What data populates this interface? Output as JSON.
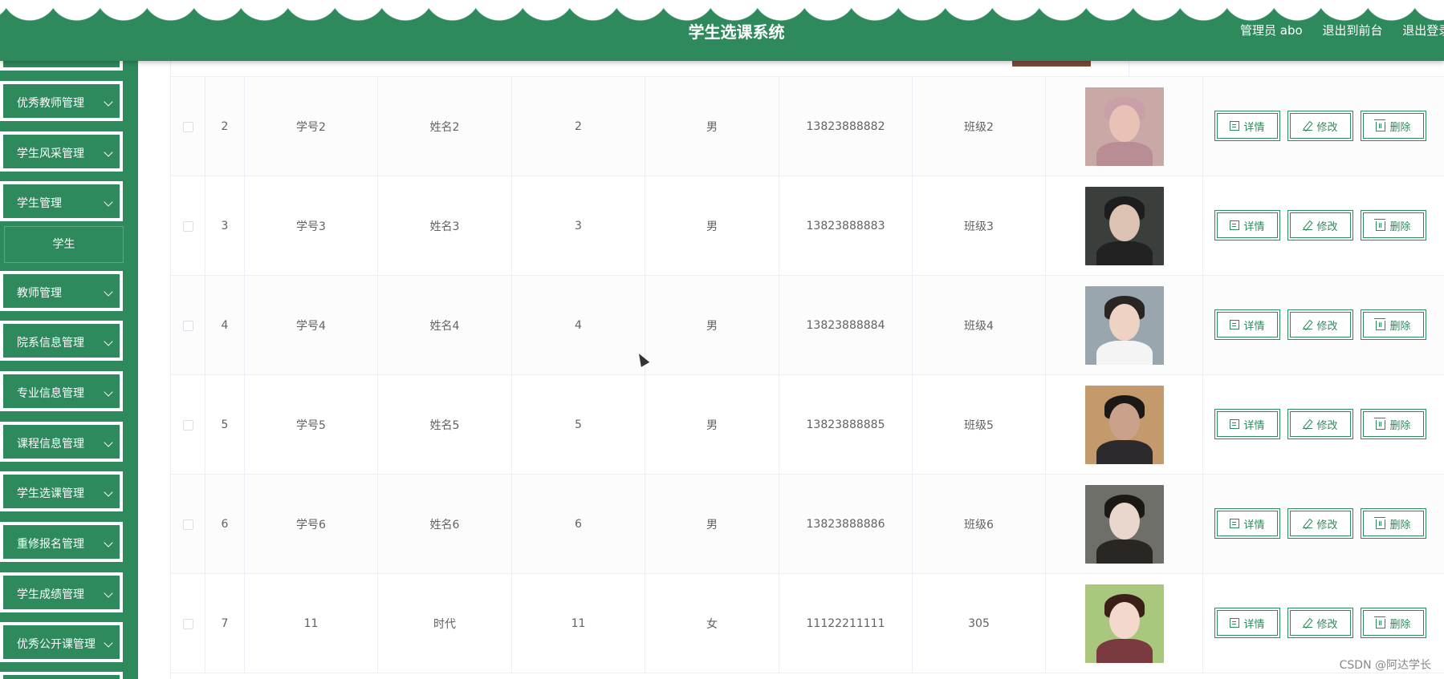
{
  "header": {
    "title": "学生选课系统",
    "user_label": "管理员 abo",
    "back_label": "退出到前台",
    "logout_label": "退出登录"
  },
  "sidebar": {
    "items": [
      {
        "label": "优秀教师管理",
        "type": "menu"
      },
      {
        "label": "学生风采管理",
        "type": "menu"
      },
      {
        "label": "学生管理",
        "type": "menu"
      },
      {
        "label": "学生",
        "type": "submenu"
      },
      {
        "label": "教师管理",
        "type": "menu"
      },
      {
        "label": "院系信息管理",
        "type": "menu"
      },
      {
        "label": "专业信息管理",
        "type": "menu"
      },
      {
        "label": "课程信息管理",
        "type": "menu"
      },
      {
        "label": "学生选课管理",
        "type": "menu"
      },
      {
        "label": "重修报名管理",
        "type": "menu"
      },
      {
        "label": "学生成绩管理",
        "type": "menu"
      },
      {
        "label": "优秀公开课管理",
        "type": "menu"
      }
    ]
  },
  "table": {
    "rows": [
      {
        "index": "2",
        "student_no": "学号2",
        "name": "姓名2",
        "age": "2",
        "gender": "男",
        "phone": "13823888882",
        "class": "班级2",
        "photo": "avatar-photo"
      },
      {
        "index": "3",
        "student_no": "学号3",
        "name": "姓名3",
        "age": "3",
        "gender": "男",
        "phone": "13823888883",
        "class": "班级3",
        "photo": "avatar-photo"
      },
      {
        "index": "4",
        "student_no": "学号4",
        "name": "姓名4",
        "age": "4",
        "gender": "男",
        "phone": "13823888884",
        "class": "班级4",
        "photo": "avatar-photo"
      },
      {
        "index": "5",
        "student_no": "学号5",
        "name": "姓名5",
        "age": "5",
        "gender": "男",
        "phone": "13823888885",
        "class": "班级5",
        "photo": "avatar-photo"
      },
      {
        "index": "6",
        "student_no": "学号6",
        "name": "姓名6",
        "age": "6",
        "gender": "男",
        "phone": "13823888886",
        "class": "班级6",
        "photo": "avatar-photo"
      },
      {
        "index": "7",
        "student_no": "11",
        "name": "时代",
        "age": "11",
        "gender": "女",
        "phone": "11122211111",
        "class": "305",
        "photo": "avatar-photo"
      }
    ],
    "actions": {
      "detail": "详情",
      "edit": "修改",
      "delete": "删除"
    }
  },
  "watermark": "CSDN @阿达学长",
  "colors": {
    "primary": "#2e8a5d",
    "border": "#ebeef5",
    "text": "#606266"
  }
}
